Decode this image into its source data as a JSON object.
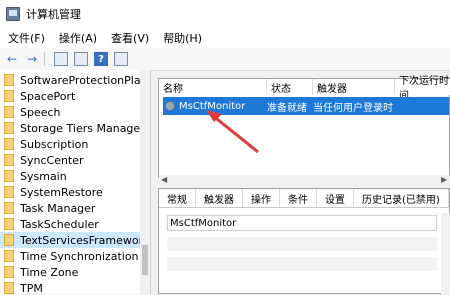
{
  "window": {
    "title": "计算机管理"
  },
  "menu": {
    "file": "文件(F)",
    "action": "操作(A)",
    "view": "查看(V)",
    "help": "帮助(H)"
  },
  "toolbar": {
    "back": "←",
    "forward": "→",
    "help": "?"
  },
  "tree": {
    "items": [
      "SoftwareProtectionPlatform",
      "SpacePort",
      "Speech",
      "Storage Tiers Management",
      "Subscription",
      "SyncCenter",
      "Sysmain",
      "SystemRestore",
      "Task Manager",
      "TaskScheduler",
      "TextServicesFramework",
      "Time Synchronization",
      "Time Zone",
      "TPM"
    ],
    "selected_index": 10
  },
  "list": {
    "columns": [
      "名称",
      "状态",
      "触发器",
      "下次运行时间"
    ],
    "row": {
      "name": "MsCtfMonitor",
      "status": "准备就绪",
      "trigger": "当任何用户登录时"
    }
  },
  "details": {
    "tabs": [
      "常规",
      "触发器",
      "操作",
      "条件",
      "设置",
      "历史记录(已禁用)"
    ],
    "name_value": "MsCtfMonitor"
  },
  "colors": {
    "selection_blue": "#1e78d7",
    "annotation_red": "#e23b3b"
  }
}
